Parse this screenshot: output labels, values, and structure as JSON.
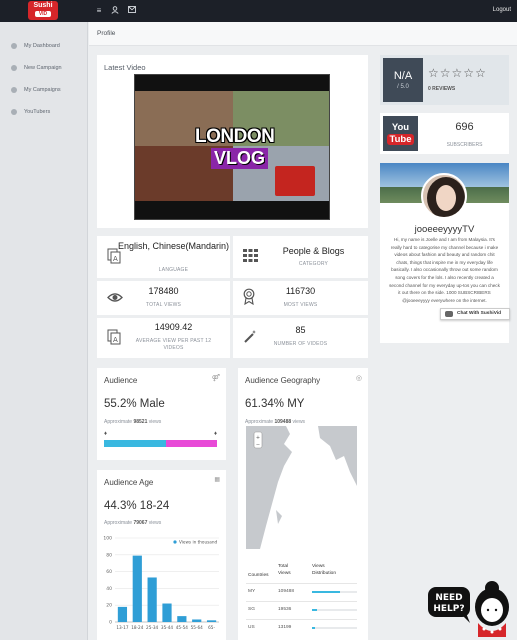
{
  "topbar": {
    "logo_text": "Sushi",
    "logo_sub": "VID",
    "logout_label": "Logout",
    "icons": [
      "menu-icon",
      "user-icon",
      "mail-icon"
    ]
  },
  "sidebar": {
    "items": [
      {
        "label": "My Dashboard",
        "icon": "dashboard-icon"
      },
      {
        "label": "New Campaign",
        "icon": "campaign-icon"
      },
      {
        "label": "My Campaigns",
        "icon": "campaigns-icon"
      },
      {
        "label": "YouTubers",
        "icon": "youtubers-icon"
      }
    ]
  },
  "breadcrumb": "Profile",
  "latest_video": {
    "title": "Latest Video",
    "overlay_line1": "LONDON",
    "overlay_line2": "VLOG"
  },
  "stats": [
    {
      "value": "English, Chinese(Mandarin)",
      "label": "LANGUAGE",
      "icon": "translate-icon"
    },
    {
      "value": "People & Blogs",
      "label": "CATEGORY",
      "icon": "grid-icon"
    },
    {
      "value": "178480",
      "label": "TOTAL VIEWS",
      "icon": "eye-icon"
    },
    {
      "value": "116730",
      "label": "MOST VIEWS",
      "icon": "award-icon"
    },
    {
      "value": "14909.42",
      "label": "AVERAGE VIEW PER PAST 12 VIDEOS",
      "icon": "translate-icon"
    },
    {
      "value": "85",
      "label": "NUMBER OF VIDEOS",
      "icon": "wand-icon"
    }
  ],
  "rating": {
    "value": "N/A",
    "scale": "/ 5.0",
    "reviews_count": "0",
    "reviews_label": "REVIEWS",
    "stars": 0,
    "stars_total": 5
  },
  "youtube": {
    "logo_line1": "You",
    "logo_line2": "Tube",
    "subscribers": "696",
    "subscribers_label": "SUBSCRIBERS"
  },
  "profile": {
    "name": "jooeeeyyyyTV",
    "bio": "Hi, my name is Joelle and I am from Malaysia. It's really hard to categorise my channel because i make videos about fashion and beauty and random chit chats, things that inspire me in my everyday life basically. I also occasionally throw out some random song covers for the lols. I also recently created a second channel for my everyday up-tos you can check it out there on the side. 1000 SUBSCRIBERS @jooeeeyyyy everywhere on the internet."
  },
  "chat_button": "Chat With SushiVid",
  "audience": {
    "title": "Audience",
    "headline": "55.2% Male",
    "approx_prefix": "Approximate",
    "approx_value": "98521",
    "approx_suffix": "views",
    "male_pct": 55.2,
    "colors": {
      "male": "#39b8e0",
      "female": "#e84ad7"
    }
  },
  "audience_geography": {
    "title": "Audience Geography",
    "headline": "61.34% MY",
    "approx_prefix": "Approximate",
    "approx_value": "109488",
    "approx_suffix": "views",
    "headers": {
      "country": "Countries",
      "views": "Total Views",
      "dist": "Views Distribution"
    },
    "rows": [
      {
        "country": "MY",
        "views": "109488",
        "share": 0.6134
      },
      {
        "country": "SG",
        "views": "19536",
        "share": 0.11
      },
      {
        "country": "US",
        "views": "13199",
        "share": 0.07
      }
    ]
  },
  "audience_age": {
    "title": "Audience Age",
    "headline": "44.3% 18-24",
    "approx_prefix": "Approximate",
    "approx_value": "79067",
    "approx_suffix": "views",
    "chart_data": {
      "type": "bar",
      "categories": [
        "13-17",
        "18-24",
        "25-34",
        "35-44",
        "45-54",
        "55-64",
        "65-"
      ],
      "series": [
        {
          "name": "Views in thousand",
          "values": [
            18,
            79,
            53,
            22,
            7,
            3,
            2
          ]
        }
      ],
      "ylim": [
        0,
        100
      ],
      "yticks": [
        0,
        20,
        40,
        60,
        80,
        100
      ],
      "grid": true,
      "legend": "top-right",
      "color": "#2f9ed6"
    }
  },
  "need_help": {
    "line1": "NEED",
    "line2": "HELP?"
  }
}
